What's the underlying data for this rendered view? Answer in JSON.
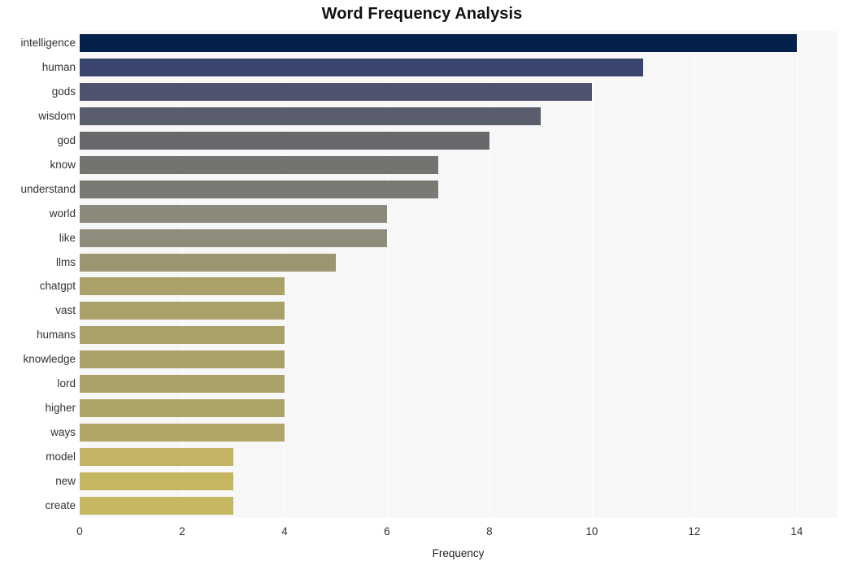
{
  "chart_data": {
    "type": "bar",
    "orientation": "horizontal",
    "title": "Word Frequency Analysis",
    "xlabel": "Frequency",
    "ylabel": "",
    "xlim": [
      0,
      14.78
    ],
    "xticks": [
      0,
      2,
      4,
      6,
      8,
      10,
      12,
      14
    ],
    "grid": "vertical-white-on-light-gray",
    "legend": "none",
    "categories": [
      "intelligence",
      "human",
      "gods",
      "wisdom",
      "god",
      "know",
      "understand",
      "world",
      "like",
      "llms",
      "chatgpt",
      "vast",
      "humans",
      "knowledge",
      "lord",
      "higher",
      "ways",
      "model",
      "new",
      "create"
    ],
    "values": [
      14,
      11,
      10,
      9,
      8,
      7,
      7,
      6,
      6,
      5,
      4,
      4,
      4,
      4,
      4,
      4,
      4,
      3,
      3,
      3
    ],
    "bar_colors": [
      "#03214b",
      "#39456e",
      "#4d536d",
      "#595d6c",
      "#67686c",
      "#74736f",
      "#7a7973",
      "#8b897a",
      "#8f8c7c",
      "#9b9570",
      "#a9a169",
      "#a9a169",
      "#a9a169",
      "#a9a169",
      "#aaa269",
      "#aca468",
      "#afa667",
      "#c3b464",
      "#c5b662",
      "#c6b763"
    ]
  },
  "figure": {
    "plot_background": "#f7f7f7",
    "page_background": "#ffffff",
    "gridline_color": "#ffffff",
    "tick_text_color": "#333333",
    "title_color": "#111111"
  }
}
